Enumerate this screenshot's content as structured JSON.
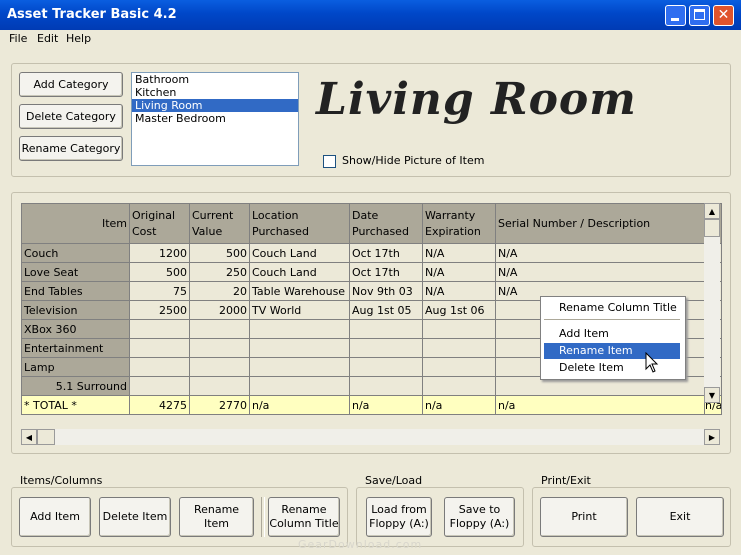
{
  "window": {
    "title": "Asset Tracker Basic 4.2"
  },
  "menu": [
    "File",
    "Edit",
    "Help"
  ],
  "category_buttons": {
    "add": "Add Category",
    "delete": "Delete Category",
    "rename": "Rename Category"
  },
  "categories": [
    "Bathroom",
    "Kitchen",
    "Living Room",
    "Master Bedroom"
  ],
  "selected_category": "Living Room",
  "current_title": "Living Room",
  "show_picture_label": "Show/Hide Picture of Item",
  "show_picture_checked": false,
  "table": {
    "headers": [
      "Item",
      "Original\nCost",
      "Current\nValue",
      "Location\nPurchased",
      "Date\nPurchased",
      "Warranty\nExpiration",
      "Serial Number / Description"
    ],
    "rows": [
      [
        "Couch",
        "1200",
        "500",
        "Couch Land",
        "Oct 17th",
        "N/A",
        "N/A"
      ],
      [
        "Love Seat",
        "500",
        "250",
        "Couch Land",
        "Oct 17th",
        "N/A",
        "N/A"
      ],
      [
        "End Tables",
        "75",
        "20",
        "Table Warehouse",
        "Nov 9th 03",
        "N/A",
        "N/A"
      ],
      [
        "Television",
        "2500",
        "2000",
        "TV World",
        "Aug 1st 05",
        "Aug 1st 06",
        ""
      ],
      [
        "XBox 360",
        "",
        "",
        "",
        "",
        "",
        ""
      ],
      [
        "Entertainment",
        "",
        "",
        "",
        "",
        "",
        ""
      ],
      [
        "Lamp",
        "",
        "",
        "",
        "",
        "",
        ""
      ],
      [
        "5.1 Surround",
        "",
        "",
        "",
        "",
        "",
        ""
      ]
    ],
    "total": [
      "* TOTAL *",
      "4275",
      "2770",
      "n/a",
      "n/a",
      "n/a",
      "n/a"
    ],
    "total_overflow": "n/a"
  },
  "context_menu": {
    "items": [
      "Rename Column Title",
      "Add Item",
      "Rename Item",
      "Delete Item"
    ],
    "highlighted": "Rename Item"
  },
  "items_columns": {
    "label": "Items/Columns",
    "add_item": "Add Item",
    "delete_item": "Delete Item",
    "rename_item": "Rename Item",
    "rename_column": "Rename\nColumn Title"
  },
  "save_load": {
    "label": "Save/Load",
    "load": "Load from\nFloppy (A:)",
    "save": "Save to\nFloppy (A:)"
  },
  "print_exit": {
    "label": "Print/Exit",
    "print": "Print",
    "exit": "Exit"
  },
  "watermark": "GearDownload.com",
  "colors": {
    "titlebar": "#0054e3",
    "selection": "#316ac5",
    "total_row": "#ffffc0",
    "header": "#aca899"
  }
}
